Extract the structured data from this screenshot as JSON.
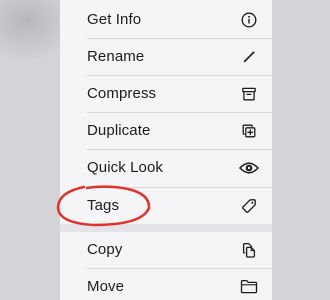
{
  "menu": {
    "items": [
      {
        "label": "Get Info",
        "icon": "info-circle-icon"
      },
      {
        "label": "Rename",
        "icon": "pencil-icon"
      },
      {
        "label": "Compress",
        "icon": "archive-box-icon"
      },
      {
        "label": "Duplicate",
        "icon": "duplicate-plus-icon"
      },
      {
        "label": "Quick Look",
        "icon": "eye-icon"
      },
      {
        "label": "Tags",
        "icon": "tag-icon"
      },
      {
        "label": "Copy",
        "icon": "copy-document-icon"
      },
      {
        "label": "Move",
        "icon": "folder-icon"
      }
    ]
  },
  "annotation": {
    "color": "#e0322d",
    "target": "Tags"
  }
}
